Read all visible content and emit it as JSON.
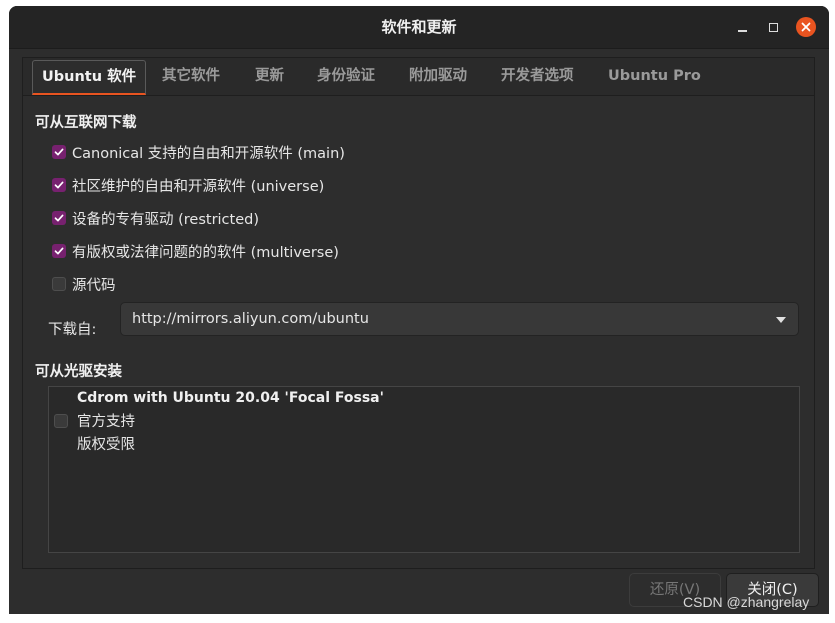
{
  "window": {
    "title": "软件和更新",
    "controls": {
      "minimize": "minimize-icon",
      "maximize": "maximize-icon",
      "close": "close-icon"
    }
  },
  "tabs": [
    {
      "label": "Ubuntu 软件",
      "active": true
    },
    {
      "label": "其它软件",
      "active": false
    },
    {
      "label": "更新",
      "active": false
    },
    {
      "label": "身份验证",
      "active": false
    },
    {
      "label": "附加驱动",
      "active": false
    },
    {
      "label": "开发者选项",
      "active": false
    },
    {
      "label": "Ubuntu Pro",
      "active": false
    }
  ],
  "internet": {
    "title": "可从互联网下载",
    "options": [
      {
        "label": "Canonical 支持的自由和开源软件 (main)",
        "checked": true
      },
      {
        "label": "社区维护的自由和开源软件 (universe)",
        "checked": true
      },
      {
        "label": "设备的专有驱动 (restricted)",
        "checked": true
      },
      {
        "label": "有版权或法律问题的的软件 (multiverse)",
        "checked": true
      },
      {
        "label": "源代码",
        "checked": false
      }
    ],
    "download_from_label": "下载自:",
    "download_from_value": "http://mirrors.aliyun.com/ubuntu"
  },
  "cdrom": {
    "title": "可从光驱安装",
    "entry_title": "Cdrom with Ubuntu 20.04 'Focal Fossa'",
    "entry_line1": "官方支持",
    "entry_line2": "版权受限",
    "checked": false
  },
  "buttons": {
    "revert": "还原(V)",
    "close": "关闭(C)"
  },
  "watermark": "CSDN @zhangrelay",
  "colors": {
    "accent": "#e95420",
    "checkbox": "#77216f",
    "background": "#2d2d2d"
  }
}
